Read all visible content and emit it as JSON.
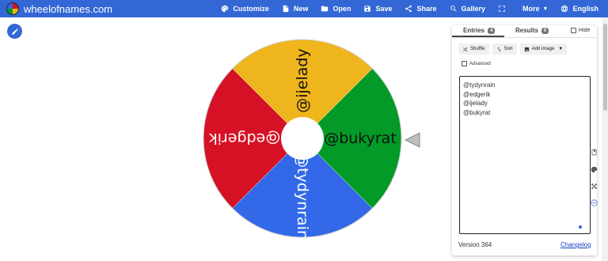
{
  "header": {
    "brand": "wheelofnames.com",
    "menu": [
      {
        "id": "customize",
        "label": "Customize",
        "icon": "palette-icon"
      },
      {
        "id": "new",
        "label": "New",
        "icon": "file-icon"
      },
      {
        "id": "open",
        "label": "Open",
        "icon": "folder-icon"
      },
      {
        "id": "save",
        "label": "Save",
        "icon": "save-icon"
      },
      {
        "id": "share",
        "label": "Share",
        "icon": "share-icon"
      },
      {
        "id": "gallery",
        "label": "Gallery",
        "icon": "search-icon"
      },
      {
        "id": "fullscreen",
        "label": "",
        "icon": "fullscreen-icon"
      },
      {
        "id": "more",
        "label": "More",
        "icon": "caret-down-icon"
      },
      {
        "id": "language",
        "label": "English",
        "icon": "globe-icon"
      }
    ]
  },
  "wheel": {
    "segments": [
      {
        "label": "@tydynrain",
        "color": "#3369e8"
      },
      {
        "label": "@edgerik",
        "color": "#d61126"
      },
      {
        "label": "@ijelady",
        "color": "#efb51c"
      },
      {
        "label": "@bukyrat",
        "color": "#039a27"
      }
    ]
  },
  "panel": {
    "tabs": {
      "entries_label": "Entries",
      "entries_count": "4",
      "results_label": "Results",
      "results_count": "0",
      "hide_label": "Hide"
    },
    "toolbar": {
      "shuffle_label": "Shuffle",
      "sort_label": "Sort",
      "add_image_label": "Add image"
    },
    "advanced_label": "Advanced",
    "entries": [
      "@tydynrain",
      "@edgerik",
      "@ijelady",
      "@bukyrat"
    ],
    "version": "Version 364",
    "changelog": "Changelog"
  },
  "colors": {
    "header_bg": "#3367d6",
    "accent": "#3367d6"
  }
}
